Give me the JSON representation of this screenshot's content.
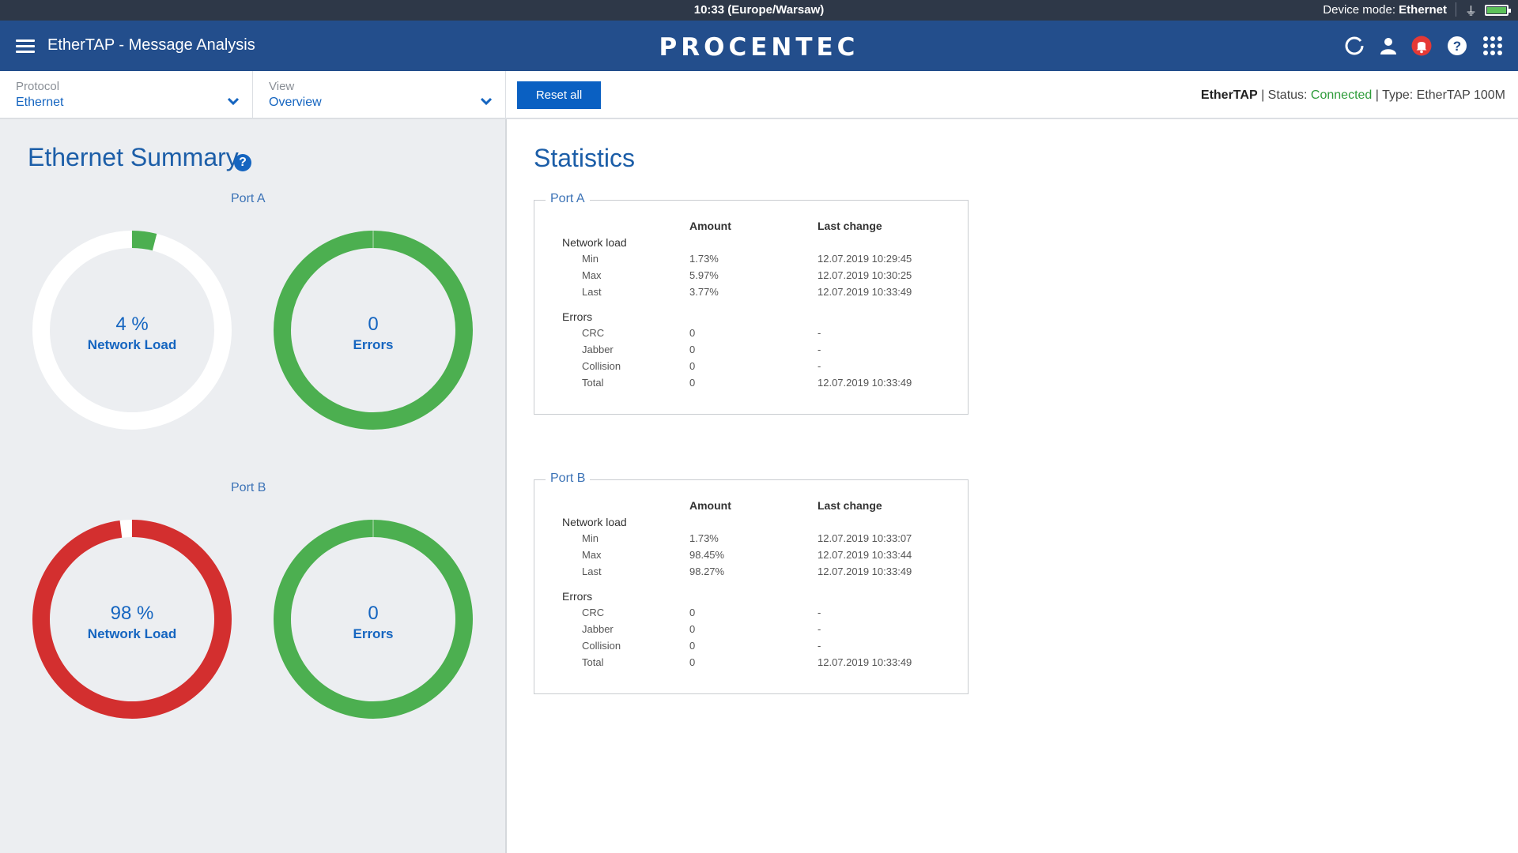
{
  "statusbar": {
    "time": "10:33 (Europe/Warsaw)",
    "device_mode_label": "Device mode: ",
    "device_mode_value": "Ethernet"
  },
  "header": {
    "app_title": "EtherTAP - Message Analysis",
    "brand": "PROCENTEC",
    "icons": [
      "refresh-icon",
      "user-icon",
      "bell-icon",
      "help-icon",
      "apps-grid-icon"
    ],
    "bell_color": "#e53935"
  },
  "toolbar": {
    "protocol_label": "Protocol",
    "protocol_value": "Ethernet",
    "view_label": "View",
    "view_value": "Overview",
    "reset_label": "Reset all",
    "device_name": "EtherTAP",
    "status_label": " | Status: ",
    "status_value": "Connected",
    "type_text": " | Type: EtherTAP 100M"
  },
  "summary": {
    "title": "Ethernet Summary",
    "help": "?",
    "ports": [
      {
        "label": "Port A",
        "load": {
          "value": "4 %",
          "caption": "Network Load",
          "fraction": 0.04,
          "color": "#4caf50",
          "track": "#ffffff"
        },
        "errors": {
          "value": "0",
          "caption": "Errors",
          "fraction": 1.0,
          "color": "#4caf50"
        }
      },
      {
        "label": "Port B",
        "load": {
          "value": "98 %",
          "caption": "Network Load",
          "fraction": 0.98,
          "color": "#d32f2f",
          "track": "#ffffff"
        },
        "errors": {
          "value": "0",
          "caption": "Errors",
          "fraction": 1.0,
          "color": "#4caf50"
        }
      }
    ]
  },
  "statistics": {
    "title": "Statistics",
    "col_amount": "Amount",
    "col_last_change": "Last change",
    "ports": [
      {
        "label": "Port A",
        "network_load_label": "Network load",
        "network_load": [
          {
            "name": "Min",
            "amount": "1.73%",
            "last": "12.07.2019 10:29:45"
          },
          {
            "name": "Max",
            "amount": "5.97%",
            "last": "12.07.2019 10:30:25"
          },
          {
            "name": "Last",
            "amount": "3.77%",
            "last": "12.07.2019 10:33:49"
          }
        ],
        "errors_label": "Errors",
        "errors": [
          {
            "name": "CRC",
            "amount": "0",
            "last": "-"
          },
          {
            "name": "Jabber",
            "amount": "0",
            "last": "-"
          },
          {
            "name": "Collision",
            "amount": "0",
            "last": "-"
          },
          {
            "name": "Total",
            "amount": "0",
            "last": "12.07.2019 10:33:49"
          }
        ]
      },
      {
        "label": "Port B",
        "network_load_label": "Network load",
        "network_load": [
          {
            "name": "Min",
            "amount": "1.73%",
            "last": "12.07.2019 10:33:07"
          },
          {
            "name": "Max",
            "amount": "98.45%",
            "last": "12.07.2019 10:33:44"
          },
          {
            "name": "Last",
            "amount": "98.27%",
            "last": "12.07.2019 10:33:49"
          }
        ],
        "errors_label": "Errors",
        "errors": [
          {
            "name": "CRC",
            "amount": "0",
            "last": "-"
          },
          {
            "name": "Jabber",
            "amount": "0",
            "last": "-"
          },
          {
            "name": "Collision",
            "amount": "0",
            "last": "-"
          },
          {
            "name": "Total",
            "amount": "0",
            "last": "12.07.2019 10:33:49"
          }
        ]
      }
    ]
  }
}
